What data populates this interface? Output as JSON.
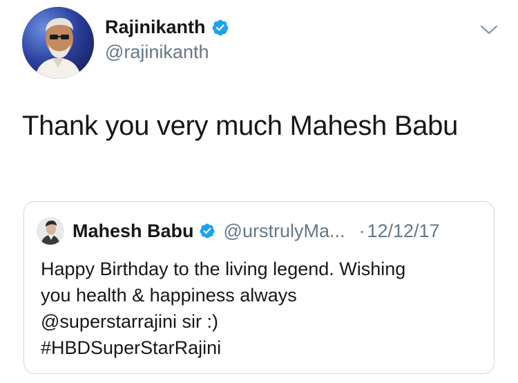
{
  "tweet": {
    "author": {
      "name": "Rajinikanth",
      "handle": "@rajinikanth",
      "verified": true,
      "avatar_icon": "profile-photo"
    },
    "menu_icon": "chevron-down-icon",
    "text": "Thank you very much Mahesh Babu",
    "quoted_tweet": {
      "author": {
        "name": "Mahesh Babu",
        "handle": "@urstrulyMa...",
        "verified": true,
        "avatar_icon": "profile-photo"
      },
      "separator": "·",
      "date": "12/12/17",
      "lines": [
        "Happy Birthday to the living legend. Wishing",
        "you health & happiness always",
        "@superstarrajini sir :)",
        "#HBDSuperStarRajini"
      ]
    }
  },
  "colors": {
    "text_primary": "#14171a",
    "text_secondary": "#657786",
    "verified_blue": "#1da1f2",
    "card_border": "#ccd6dd"
  }
}
